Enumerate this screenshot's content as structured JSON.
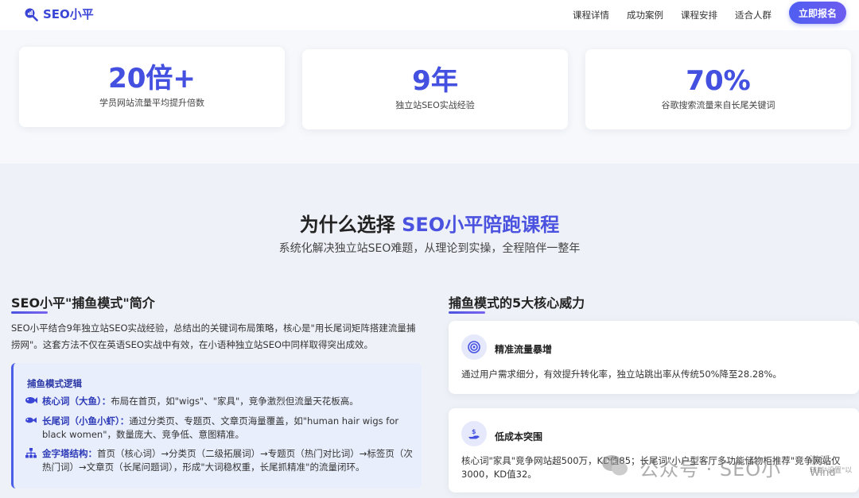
{
  "header": {
    "brand": "SEO小平",
    "nav": [
      "课程详情",
      "成功案例",
      "课程安排",
      "适合人群"
    ],
    "cta": "立即报名"
  },
  "stats": [
    {
      "value": "20倍+",
      "label": "学员网站流量平均提升倍数"
    },
    {
      "value": "9年",
      "label": "独立站SEO实战经验"
    },
    {
      "value": "70%",
      "label": "谷歌搜索流量来自长尾关键词"
    }
  ],
  "section": {
    "title_prefix": "为什么选择 ",
    "title_highlight": "SEO小平陪跑课程",
    "subtitle": "系统化解决独立站SEO难题，从理论到实操，全程陪伴一整年"
  },
  "left": {
    "heading": "SEO小平\"捕鱼模式\"简介",
    "intro": "SEO小平结合9年独立站SEO实战经验，总结出的关键词布局策略，核心是\"用长尾词矩阵搭建流量捕捞网\"。这套方法不仅在英语SEO实战中有效，在小语种独立站SEO中同样取得突出成效。",
    "logic": {
      "title": "捕鱼模式逻辑",
      "rows": [
        {
          "icon": "fish-icon",
          "term": "核心词（大鱼）：",
          "text": "布局在首页，如\"wigs\"、\"家具\"，竞争激烈但流量天花板高。"
        },
        {
          "icon": "shrimp-icon",
          "term": "长尾词（小鱼小虾）：",
          "text": "通过分类页、专题页、文章页海量覆盖，如\"human hair wigs for black women\"，数量庞大、竞争低、意图精准。"
        },
        {
          "icon": "sitemap-icon",
          "term": "金字塔结构：",
          "text": "首页（核心词）→分类页（二级拓展词）→专题页（热门对比词）→标签页（次热门词）→文章页（长尾问题词），形成\"大词稳权重，长尾抓精准\"的流量闭环。"
        }
      ]
    }
  },
  "right": {
    "heading": "捕鱼模式的5大核心威力",
    "cards": [
      {
        "icon": "target-icon",
        "title": "精准流量暴增",
        "desc": "通过用户需求细分，有效提升转化率，独立站跳出率从传统50%降至28.28%。"
      },
      {
        "icon": "money-hand-icon",
        "title": "低成本突围",
        "desc": "核心词\"家具\"竞争网站超500万，KD值85；长尾词\"小户型客厅多功能储物柜推荐\"竞争网站仅3000，KD值32。"
      }
    ]
  },
  "overlay": {
    "watermark": "公众号 · SEO小",
    "activate": "激活 Wind",
    "activate_sub": "转到\"设置\"以"
  }
}
